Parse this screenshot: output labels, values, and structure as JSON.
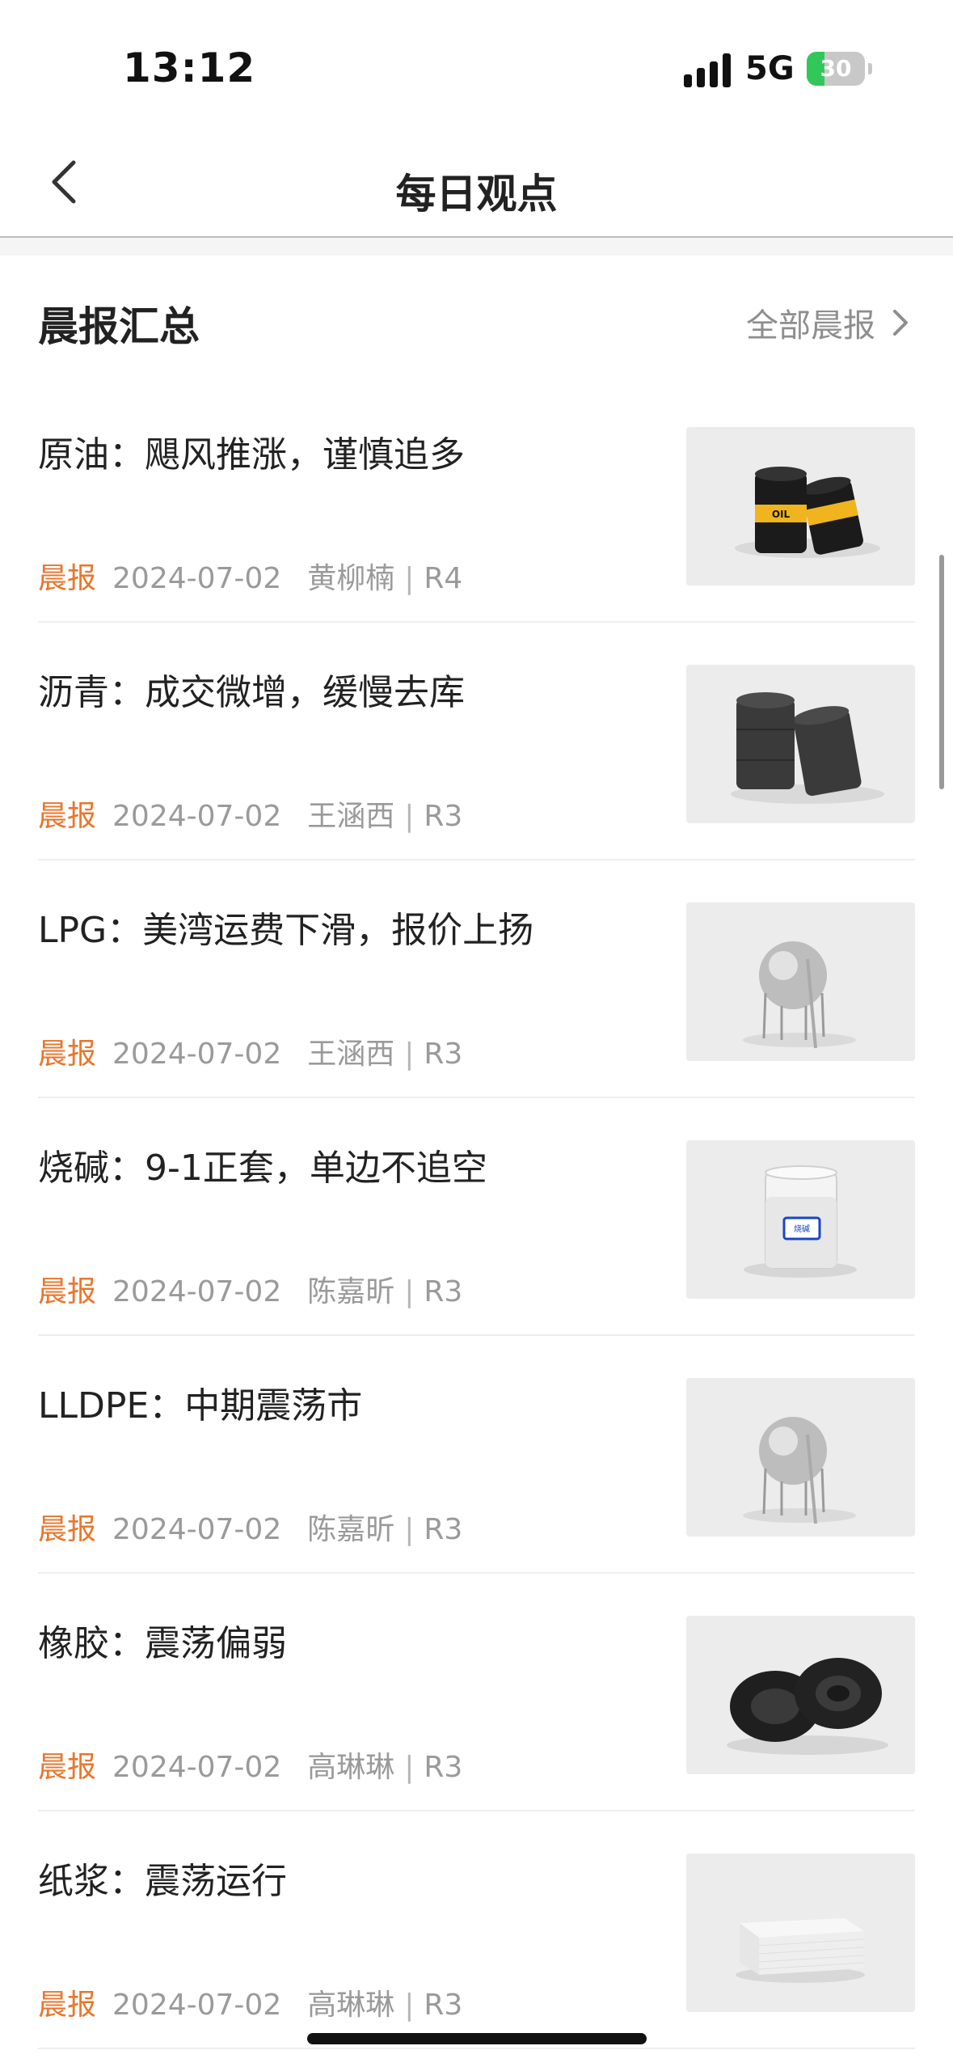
{
  "status_bar": {
    "time": "13:12",
    "network": "5G",
    "battery": "30",
    "battery_level": 0.3,
    "battery_color": "#32c75a"
  },
  "nav": {
    "title": "每日观点",
    "back_icon": "chevron-left-icon"
  },
  "section": {
    "title": "晨报汇总",
    "view_all": "全部晨报",
    "view_all_icon": "chevron-right-icon"
  },
  "accent_color": "#e8762c",
  "items": [
    {
      "title": "原油：飓风推涨，谨慎追多",
      "tag": "晨报",
      "date": "2024-07-02",
      "author": "黄柳楠",
      "risk": "R4",
      "image": "oil-barrels-image"
    },
    {
      "title": "沥青：成交微增，缓慢去库",
      "tag": "晨报",
      "date": "2024-07-02",
      "author": "王涵西",
      "risk": "R3",
      "image": "asphalt-barrels-image"
    },
    {
      "title": "LPG：美湾运费下滑，报价上扬",
      "tag": "晨报",
      "date": "2024-07-02",
      "author": "王涵西",
      "risk": "R3",
      "image": "gas-tank-image"
    },
    {
      "title": "烧碱：9-1正套，单边不追空",
      "tag": "晨报",
      "date": "2024-07-02",
      "author": "陈嘉昕",
      "risk": "R3",
      "image": "caustic-soda-jar-image",
      "image_label": "烧碱"
    },
    {
      "title": "LLDPE：中期震荡市",
      "tag": "晨报",
      "date": "2024-07-02",
      "author": "陈嘉昕",
      "risk": "R3",
      "image": "gas-tank-image"
    },
    {
      "title": "橡胶：震荡偏弱",
      "tag": "晨报",
      "date": "2024-07-02",
      "author": "高琳琳",
      "risk": "R3",
      "image": "tires-image"
    },
    {
      "title": "纸浆：震荡运行",
      "tag": "晨报",
      "date": "2024-07-02",
      "author": "高琳琳",
      "risk": "R3",
      "image": "paper-stack-image"
    }
  ]
}
